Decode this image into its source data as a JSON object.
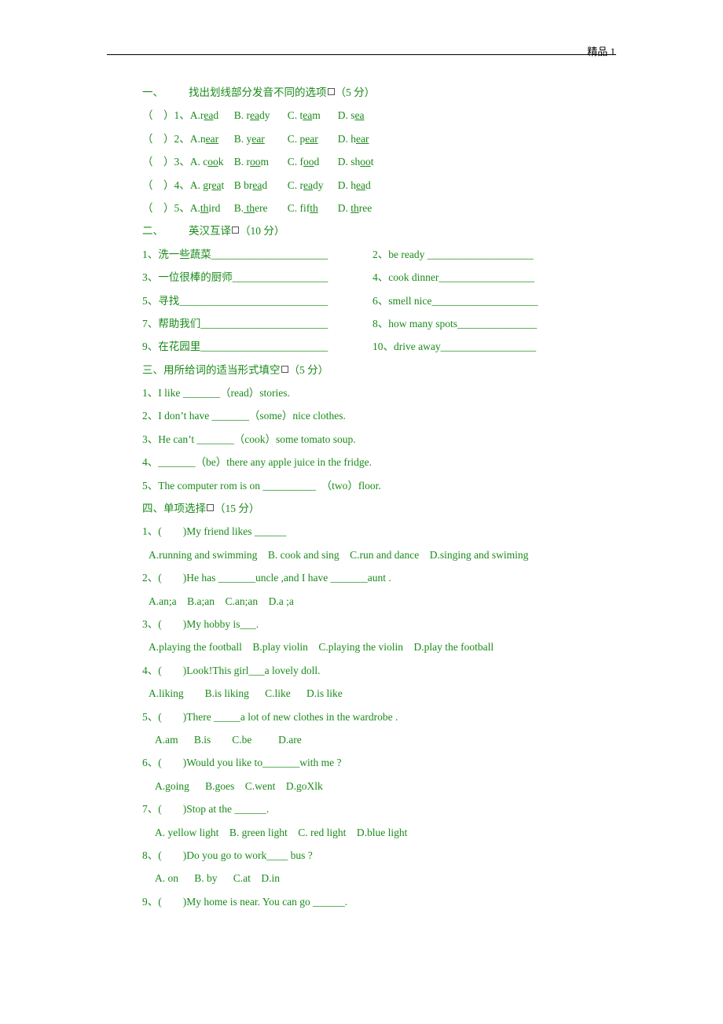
{
  "header": {
    "label": "精品 1"
  },
  "section1": {
    "title_num": "一、",
    "title_text": "找出划线部分发音不同的选项",
    "title_score": "（5 分）",
    "items": [
      {
        "prefix": "（    ）1、",
        "a_pre": "A.r",
        "a_u": "ea",
        "a_post": "d",
        "b_pre": "B. r",
        "b_u": "ea",
        "b_post": "dy",
        "c_pre": "C. t",
        "c_u": "ea",
        "c_post": "m",
        "d_pre": "D. s",
        "d_u": "ea",
        "d_post": ""
      },
      {
        "prefix": "（    ）2、",
        "a_pre": "A.n",
        "a_u": "ear",
        "a_post": "",
        "b_pre": "B. y",
        "b_u": "ear",
        "b_post": "",
        "c_pre": "C. p",
        "c_u": "ear",
        "c_post": "",
        "d_pre": "D. h",
        "d_u": "ear",
        "d_post": ""
      },
      {
        "prefix": "（    ）3、",
        "a_pre": "A. c",
        "a_u": "oo",
        "a_post": "k",
        "b_pre": "B. r",
        "b_u": "oo",
        "b_post": "m",
        "c_pre": "C. f",
        "c_u": "oo",
        "c_post": "d",
        "d_pre": "D. sh",
        "d_u": "oo",
        "d_post": "t"
      },
      {
        "prefix": "（    ）4、",
        "a_pre": "A. gr",
        "a_u": "ea",
        "a_post": "t",
        "b_pre": "B br",
        "b_u": "ea",
        "b_post": "d",
        "c_pre": "C. r",
        "c_u": "ea",
        "c_post": "dy",
        "d_pre": "D. h",
        "d_u": "ea",
        "d_post": "d"
      },
      {
        "prefix": "（    ）5、",
        "a_pre": "A.",
        "a_u": "th",
        "a_post": "ird",
        "b_pre": "B.",
        "b_u": " th",
        "b_post": "ere",
        "c_pre": "C. fif",
        "c_u": "th",
        "c_post": "",
        "d_pre": "D. ",
        "d_u": "th",
        "d_post": "ree"
      }
    ]
  },
  "section2": {
    "title_num": "二、",
    "title_text": "英汉互译",
    "title_score": "（10 分）",
    "rows": [
      {
        "left": "1、洗一些蔬菜______________________",
        "right": "2、be ready ____________________"
      },
      {
        "left": "3、一位很棒的厨师__________________",
        "right": "4、cook dinner__________________"
      },
      {
        "left": "5、寻找____________________________",
        "right": "6、smell nice____________________"
      },
      {
        "left": "7、帮助我们________________________",
        "right": "8、how many spots_______________"
      },
      {
        "left": "9、在花园里________________________",
        "right": "10、drive away__________________"
      }
    ]
  },
  "section3": {
    "title_text": "三、用所给词的适当形式填空",
    "title_score": "（5 分）",
    "items": [
      "1、I like _______（read）stories.",
      "2、I don’t have _______（some）nice clothes.",
      "3、He can’t _______（cook）some tomato soup.",
      "4、_______（be）there any apple juice in the fridge.",
      "5、The computer rom is on __________  （two）floor."
    ]
  },
  "section4": {
    "title_text": "四、单项选择",
    "title_score": "（15 分）",
    "questions": [
      {
        "q": "1、(        )My friend likes ______",
        "options": "A.running and swimming    B. cook and sing    C.run and dance    D.singing and swiming",
        "indent": 1
      },
      {
        "q": "2、(        )He has _______uncle ,and I have _______aunt .",
        "options": "A.an;a    B.a;an    C.an;an    D.a ;a",
        "indent": 1
      },
      {
        "q": "3、(        )My hobby is___.",
        "options": "A.playing the football    B.play violin    C.playing the violin    D.play the football",
        "indent": 1
      },
      {
        "q": "4、(        )Look!This girl___a lovely doll.",
        "options": "A.liking        B.is liking      C.like      D.is like",
        "indent": 1
      },
      {
        "q": "5、(        )There _____a lot of new clothes in the wardrobe .",
        "options": "A.am      B.is        C.be          D.are",
        "indent": 2
      },
      {
        "q": "6、(        )Would you like to_______with me ?",
        "options": "A.going      B.goes    C.went    D.goXlk",
        "indent": 2
      },
      {
        "q": "7、(        )Stop at the ______.",
        "options": "A. yellow light    B. green light    C. red light    D.blue light",
        "indent": 2
      },
      {
        "q": "8、(        )Do you go to work____ bus ?",
        "options": "A. on      B. by      C.at    D.in",
        "indent": 2
      },
      {
        "q": "9、(        )My home is near. You can go ______.",
        "options": "",
        "indent": 2
      }
    ]
  }
}
